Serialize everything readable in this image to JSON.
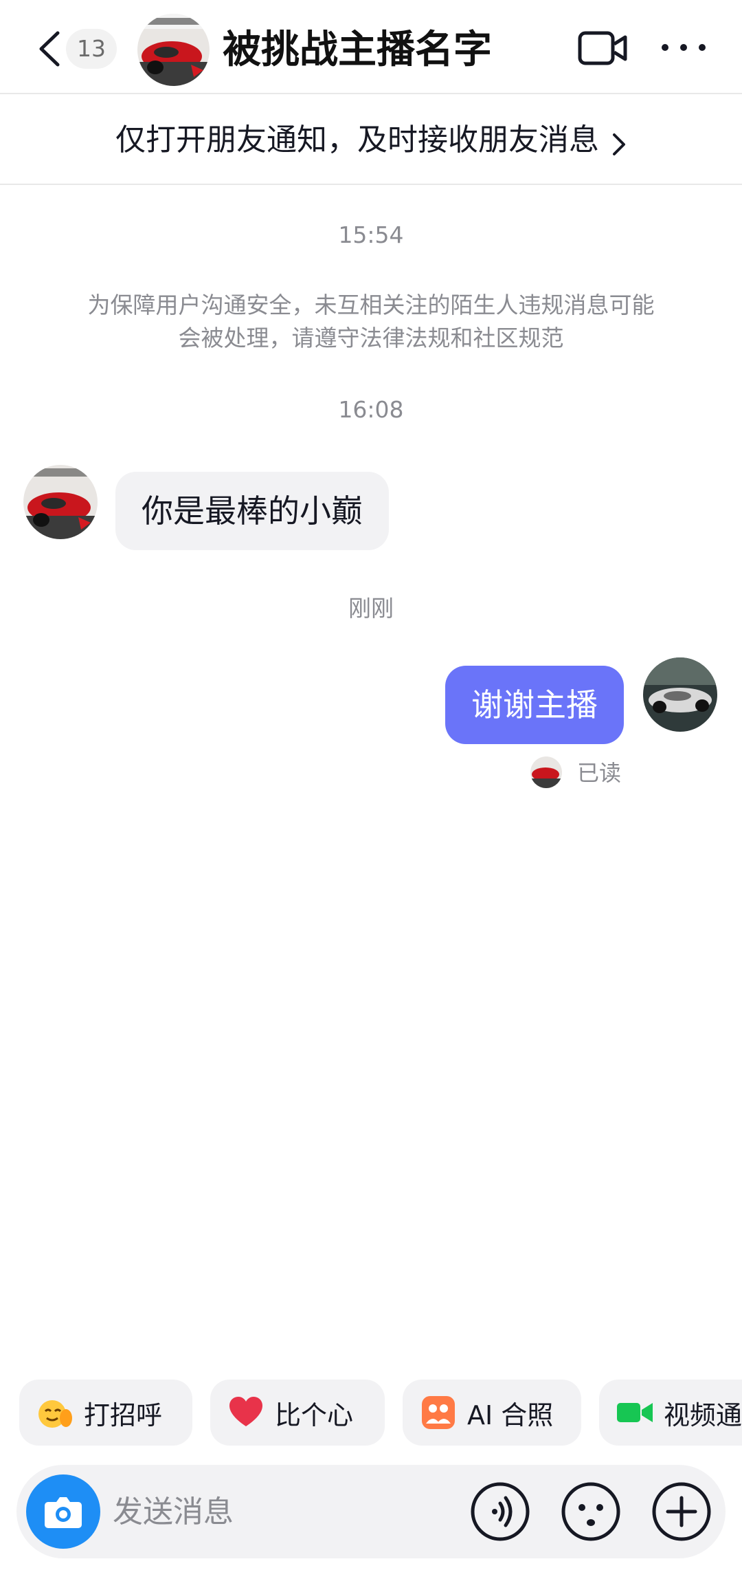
{
  "header": {
    "unread_count": "13",
    "title": "被挑战主播名字"
  },
  "notify_bar": {
    "text": "仅打开朋友通知，及时接收朋友消息"
  },
  "messages": {
    "time_1": "15:54",
    "system_notice": "为保障用户沟通安全，未互相关注的陌生人违规消息可能会被处理，请遵守法律法规和社区规范",
    "time_2": "16:08",
    "incoming_text": "你是最棒的小巅",
    "time_3": "刚刚",
    "outgoing_text": "谢谢主播",
    "read_status": "已读"
  },
  "quick_actions": [
    {
      "label": "打招呼",
      "icon": "wave-hand-icon"
    },
    {
      "label": "比个心",
      "icon": "heart-icon"
    },
    {
      "label": "AI 合照",
      "icon": "ai-photo-icon"
    },
    {
      "label": "视频通话",
      "icon": "video-call-icon"
    }
  ],
  "composer": {
    "placeholder": "发送消息"
  },
  "colors": {
    "outgoing_bubble": "#6a74f9",
    "camera_button": "#1e8ef5",
    "heart": "#e8334a",
    "video_green": "#17c653"
  }
}
